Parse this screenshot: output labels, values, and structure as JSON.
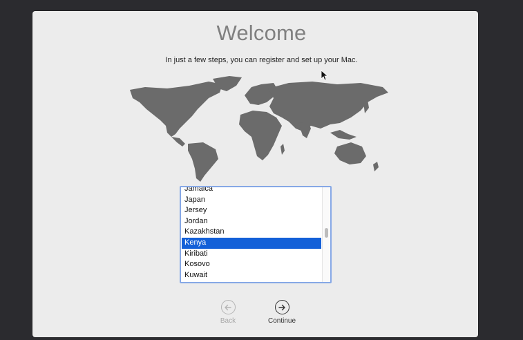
{
  "window": {
    "title": "Welcome",
    "subtitle": "In just a few steps, you can register and set up your Mac."
  },
  "map": {
    "icon": "world-map-icon",
    "color": "#6b6b6b"
  },
  "country_list": {
    "items": [
      "Jamaica",
      "Japan",
      "Jersey",
      "Jordan",
      "Kazakhstan",
      "Kenya",
      "Kiribati",
      "Kosovo",
      "Kuwait"
    ],
    "selected": "Kenya"
  },
  "nav": {
    "back_label": "Back",
    "continue_label": "Continue"
  },
  "colors": {
    "accent": "#1360d8",
    "focus_ring": "#86a8e6",
    "panel": "#ececec",
    "background": "#2b2b2f"
  }
}
